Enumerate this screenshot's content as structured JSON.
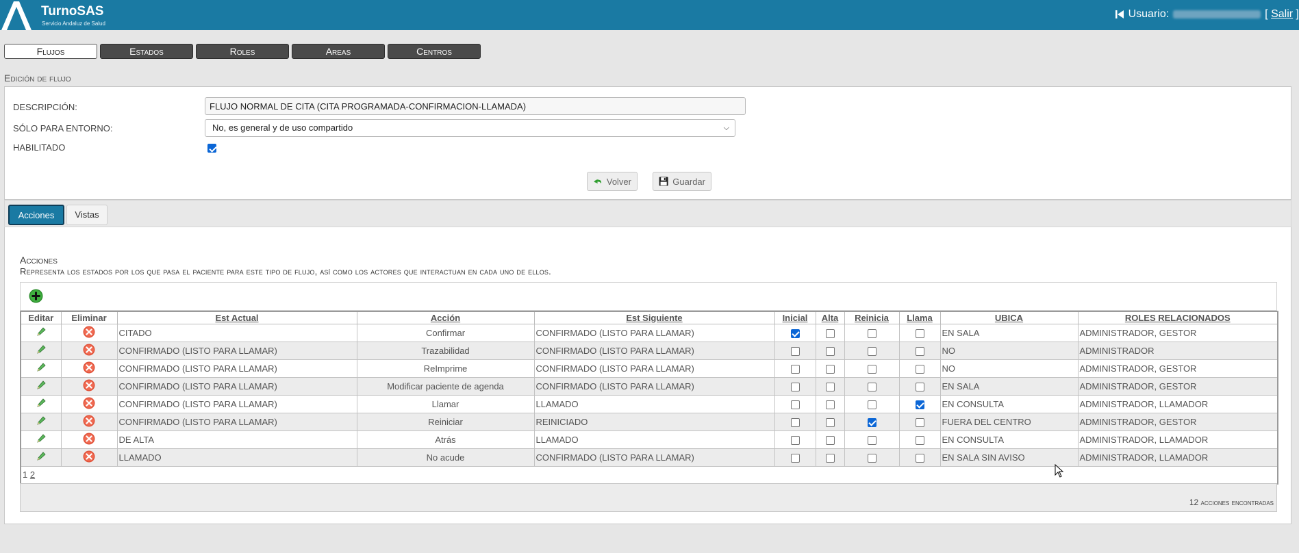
{
  "header": {
    "app_title": "TurnoSAS",
    "app_subtitle": "Servicio Andaluz de Salud",
    "user_label": "Usuario:",
    "salir_open": "[",
    "salir_label": "Salir",
    "salir_close": "]"
  },
  "nav": {
    "items": [
      "Flujos",
      "Estados",
      "Roles",
      "Areas",
      "Centros"
    ],
    "active": "Flujos"
  },
  "edit": {
    "section_title": "Edición de flujo",
    "descripcion_label": "DESCRIPCIÓN:",
    "descripcion_value": "FLUJO NORMAL DE CITA (CITA PROGRAMADA-CONFIRMACION-LLAMADA)",
    "entorno_label": "SÓLO PARA ENTORNO:",
    "entorno_value": "No, es general y de uso compartido",
    "habilitado_label": "HABILITADO",
    "habilitado": true,
    "volver_label": "Volver",
    "guardar_label": "Guardar"
  },
  "tabs": {
    "items": [
      "Acciones",
      "Vistas"
    ],
    "active": "Acciones"
  },
  "acciones": {
    "title": "Acciones",
    "subtitle": "Representa los estados por los que pasa el paciente para este tipo de flujo, así como los actores que interactuan en cada uno de ellos.",
    "columns": [
      "Editar",
      "Eliminar",
      "Est Actual",
      "Acción",
      "Est Siguiente",
      "Inicial",
      "Alta",
      "Reinicia",
      "Llama",
      "UBICA",
      "ROLES RELACIONADOS"
    ],
    "rows": [
      {
        "est_actual": "CITADO",
        "accion": "Confirmar",
        "est_siguiente": "CONFIRMADO (LISTO PARA LLAMAR)",
        "inicial": true,
        "alta": false,
        "reinicia": false,
        "llama": false,
        "ubica": "EN SALA",
        "roles": "ADMINISTRADOR, GESTOR"
      },
      {
        "est_actual": "CONFIRMADO (LISTO PARA LLAMAR)",
        "accion": "Trazabilidad",
        "est_siguiente": "CONFIRMADO (LISTO PARA LLAMAR)",
        "inicial": false,
        "alta": false,
        "reinicia": false,
        "llama": false,
        "ubica": "NO",
        "roles": "ADMINISTRADOR"
      },
      {
        "est_actual": "CONFIRMADO (LISTO PARA LLAMAR)",
        "accion": "ReImprime",
        "est_siguiente": "CONFIRMADO (LISTO PARA LLAMAR)",
        "inicial": false,
        "alta": false,
        "reinicia": false,
        "llama": false,
        "ubica": "NO",
        "roles": "ADMINISTRADOR, GESTOR"
      },
      {
        "est_actual": "CONFIRMADO (LISTO PARA LLAMAR)",
        "accion": "Modificar paciente de agenda",
        "est_siguiente": "CONFIRMADO (LISTO PARA LLAMAR)",
        "inicial": false,
        "alta": false,
        "reinicia": false,
        "llama": false,
        "ubica": "EN SALA",
        "roles": "ADMINISTRADOR, GESTOR"
      },
      {
        "est_actual": "CONFIRMADO (LISTO PARA LLAMAR)",
        "accion": "Llamar",
        "est_siguiente": "LLAMADO",
        "inicial": false,
        "alta": false,
        "reinicia": false,
        "llama": true,
        "ubica": "EN CONSULTA",
        "roles": "ADMINISTRADOR, LLAMADOR"
      },
      {
        "est_actual": "CONFIRMADO (LISTO PARA LLAMAR)",
        "accion": "Reiniciar",
        "est_siguiente": "REINICIADO",
        "inicial": false,
        "alta": false,
        "reinicia": true,
        "llama": false,
        "ubica": "FUERA DEL CENTRO",
        "roles": "ADMINISTRADOR, GESTOR"
      },
      {
        "est_actual": "DE ALTA",
        "accion": "Atrás",
        "est_siguiente": "LLAMADO",
        "inicial": false,
        "alta": false,
        "reinicia": false,
        "llama": false,
        "ubica": "EN CONSULTA",
        "roles": "ADMINISTRADOR, LLAMADOR"
      },
      {
        "est_actual": "LLAMADO",
        "accion": "No acude",
        "est_siguiente": "CONFIRMADO (LISTO PARA LLAMAR)",
        "inicial": false,
        "alta": false,
        "reinicia": false,
        "llama": false,
        "ubica": "EN SALA SIN AVISO",
        "roles": "ADMINISTRADOR, LLAMADOR"
      }
    ],
    "pager": {
      "current": "1",
      "pages": [
        "2"
      ]
    },
    "found_text": "12 acciones encontradas"
  },
  "colors": {
    "header_bg": "#1a7aa3",
    "active_tab": "#1a7aa3",
    "checkbox_on": "#0b66d6"
  }
}
